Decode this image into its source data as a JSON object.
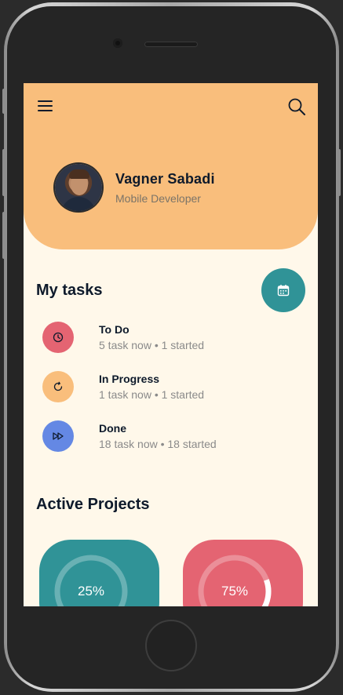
{
  "profile": {
    "name": "Vagner Sabadi",
    "role": "Mobile Developer"
  },
  "sections": {
    "my_tasks": "My tasks",
    "active_projects": "Active Projects"
  },
  "tasks": [
    {
      "title": "To Do",
      "subtitle": "5 task now • 1 started",
      "color": "#e46472",
      "icon": "clock-icon"
    },
    {
      "title": "In Progress",
      "subtitle": "1 task now • 1 started",
      "color": "#f9be7c",
      "icon": "refresh-icon"
    },
    {
      "title": "Done",
      "subtitle": "18 task now • 18 started",
      "color": "#6488e4",
      "icon": "fast-forward-icon"
    }
  ],
  "projects": [
    {
      "percent_label": "25%",
      "progress": 0.25,
      "color": "#309397"
    },
    {
      "percent_label": "75%",
      "progress": 0.75,
      "color": "#e46472"
    }
  ],
  "colors": {
    "header": "#f9be7c",
    "background": "#fff8ea",
    "accent_teal": "#309397",
    "text_dark": "#0e1a2b"
  },
  "icons": {
    "menu": "menu-icon",
    "search": "search-icon",
    "calendar": "calendar-icon"
  }
}
